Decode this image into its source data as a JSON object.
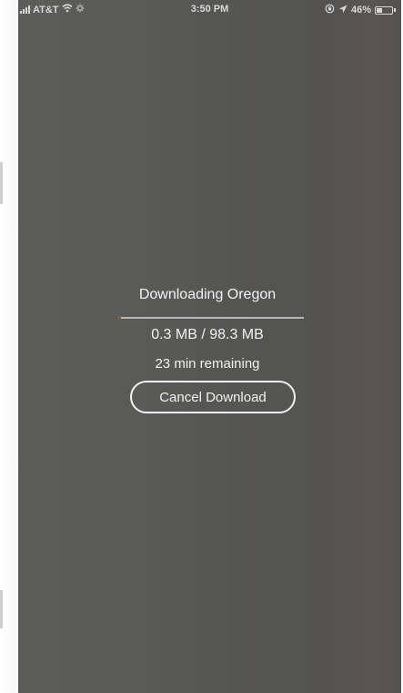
{
  "status_bar": {
    "carrier": "AT&T",
    "time": "3:50 PM",
    "battery_percent": "46%",
    "battery_level": 0.46,
    "icons": [
      "signal-icon",
      "wifi-icon",
      "brightness-icon",
      "orientation-lock-icon",
      "location-arrow-icon",
      "battery-icon"
    ]
  },
  "download": {
    "title": "Downloading Oregon",
    "size": "0.3 MB / 98.3 MB",
    "progress": 0.003,
    "remaining": "23 min remaining",
    "cancel_label": "Cancel Download"
  },
  "colors": {
    "background": "#575755",
    "text": "#f2f2f2",
    "progress_accent": "#e0392b",
    "progress_track": "#b8b8b8"
  }
}
